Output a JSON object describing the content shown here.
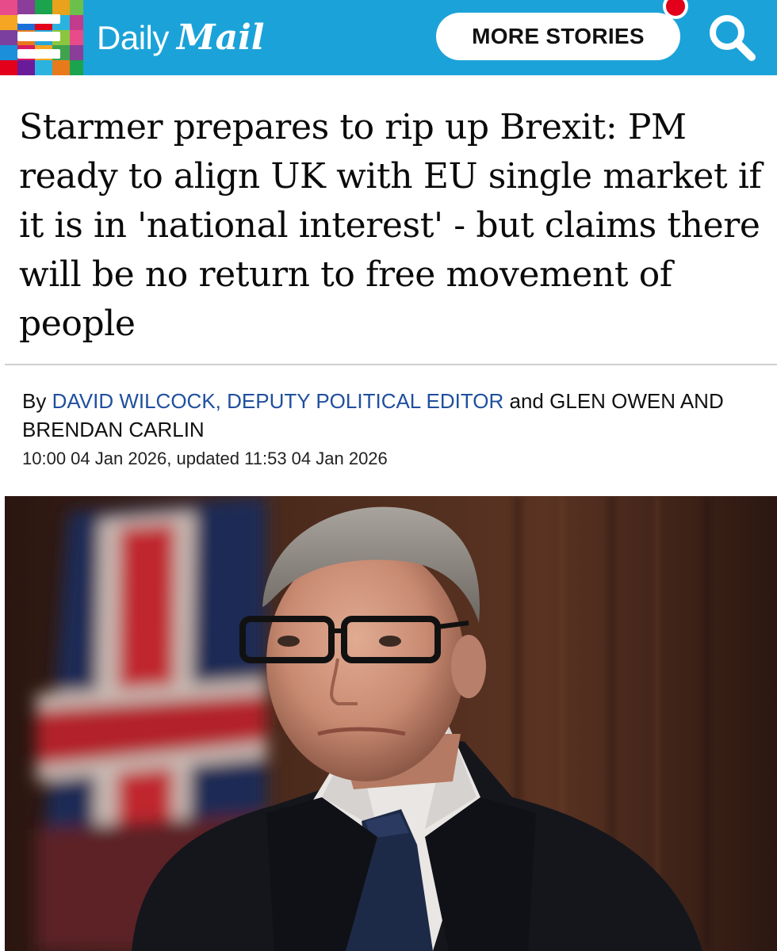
{
  "header": {
    "brand_first": "Daily",
    "brand_second": "Mail",
    "more_stories_label": "MORE STORIES",
    "icons": [
      "menu-icon",
      "notification-dot",
      "search-icon"
    ],
    "colors": {
      "header_bg": "#1ba3d9",
      "notification": "#e3001b"
    }
  },
  "article": {
    "headline": "Starmer prepares to rip up Brexit: PM ready to align UK with EU single market if it is in 'national interest' - but claims there will be no return to free movement of people",
    "byline_prefix": "By",
    "author_primary": "DAVID WILCOCK, DEPUTY POLITICAL EDITOR",
    "byline_joiner": "and",
    "author_secondary": "GLEN OWEN AND BRENDAN CARLIN",
    "timestamp": "10:00 04 Jan 2026, updated 11:53 04 Jan 2026",
    "author_link_color": "#1f4f9e"
  }
}
